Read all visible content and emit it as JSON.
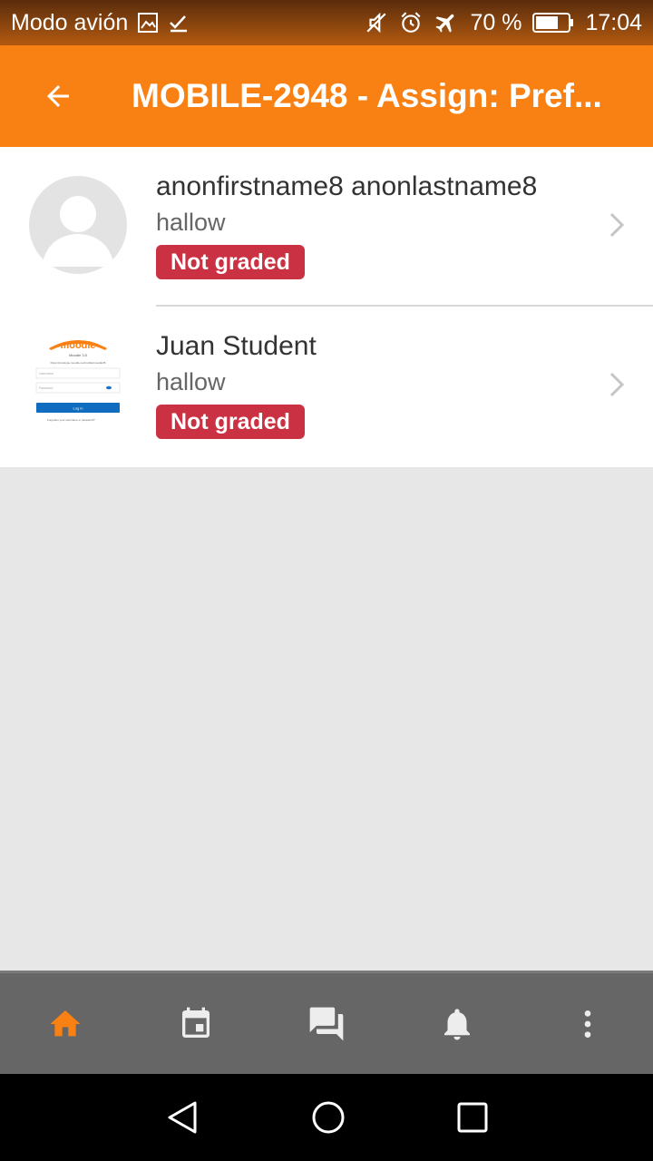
{
  "status_bar": {
    "left_text": "Modo avión",
    "battery": "70 %",
    "time": "17:04"
  },
  "header": {
    "title": "MOBILE-2948 - Assign: Pref..."
  },
  "submissions": [
    {
      "name": "anonfirstname8 anonlastname8",
      "text": "hallow",
      "status": "Not graded"
    },
    {
      "name": "Juan Student",
      "text": "hallow",
      "status": "Not graded"
    }
  ],
  "colors": {
    "accent": "#f98012",
    "badge": "#ca3142",
    "tab_active": "#f98012",
    "tab_inactive": "#ededed"
  },
  "tabs": [
    "home-icon",
    "calendar-icon",
    "messages-icon",
    "notifications-icon",
    "more-icon"
  ],
  "thumbnail": {
    "logo_text": "moodle",
    "version": "Moodle 3.5",
    "url": "https://prototype.moodle.net/mobile/moodle35",
    "username": "Username",
    "password": "Password",
    "login": "Log in",
    "forgot": "Forgotten your username or password?"
  }
}
